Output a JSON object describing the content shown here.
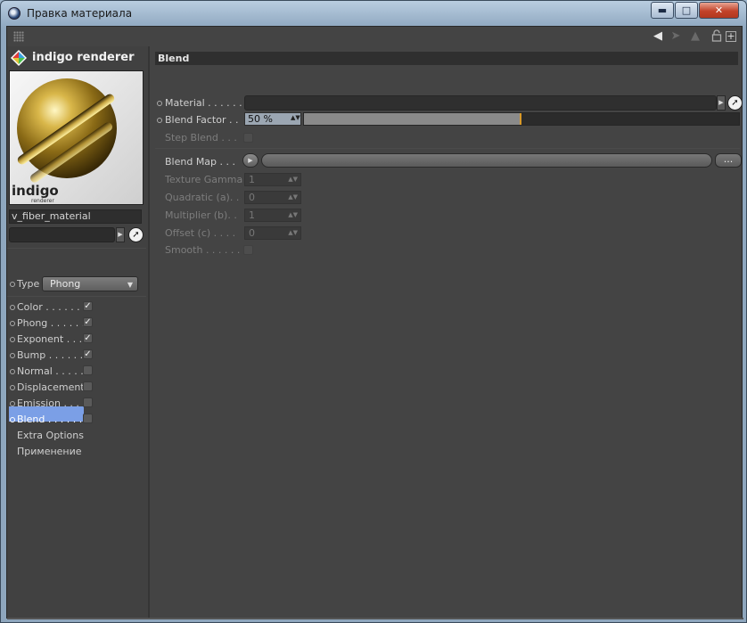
{
  "window": {
    "title": "Правка материала",
    "minimize": "▬",
    "maximize": "□",
    "close": "✕"
  },
  "toolbar": {
    "icons": [
      "grip-icon",
      "back-arrow-icon",
      "forward-arrow-icon",
      "up-arrow-icon",
      "lock-icon",
      "new-window-icon"
    ],
    "new_window_glyph": "+"
  },
  "sidebar": {
    "brand": "indigo renderer",
    "preview_watermark": "indigo",
    "preview_watermark_sub": "renderer",
    "material_name": "v_fiber_material",
    "type_label": "Type",
    "type_value": "Phong",
    "channels": [
      {
        "label": "Color . . . . . . .",
        "checked": true
      },
      {
        "label": "Phong . . . . . .",
        "checked": true
      },
      {
        "label": "Exponent  . . .",
        "checked": true
      },
      {
        "label": "Bump . . . . . . .",
        "checked": true
      },
      {
        "label": "Normal  . . . . .",
        "checked": false
      },
      {
        "label": "Displacement",
        "checked": false
      },
      {
        "label": "Emission . . . .",
        "checked": false
      },
      {
        "label": "Blend . . . . . . .",
        "checked": false,
        "selected": true
      }
    ],
    "extra_items": [
      "Extra Options",
      "Применение"
    ]
  },
  "main": {
    "section_title": "Blend",
    "material_label": "Material . . . . . .",
    "blend_factor_label": "Blend Factor . .",
    "blend_factor_value": "50 %",
    "blend_factor_fraction": 0.5,
    "step_blend_label": "Step Blend . . .",
    "blend_map_label": "Blend Map . . .",
    "blend_map_more": "...",
    "texture_gamma_label": "Texture Gamma",
    "texture_gamma_value": "1",
    "quadratic_label": "Quadratic (a). .",
    "quadratic_value": "0",
    "multiplier_label": "Multiplier (b). .",
    "multiplier_value": "1",
    "offset_label": "Offset (c) . . . .",
    "offset_value": "0",
    "smooth_label": "Smooth . . . . . ."
  },
  "colors": {
    "selected_channel": "#7b9fe6",
    "slider_marker": "#d99a2a",
    "panel_bg": "#444444"
  }
}
